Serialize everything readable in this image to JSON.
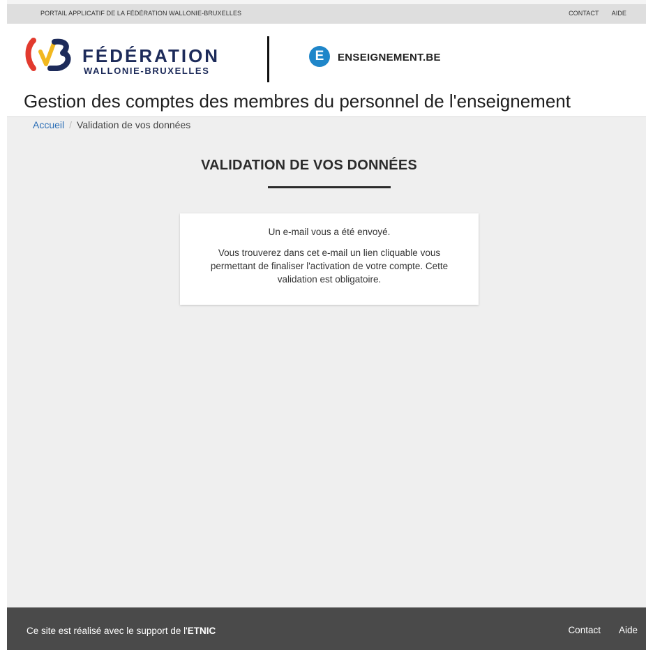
{
  "topbar": {
    "portal_text": "PORTAIL APPLICATIF DE LA FÉDÉRATION WALLONIE-BRUXELLES",
    "contact": "CONTACT",
    "aide": "AIDE"
  },
  "header": {
    "fwb_title": "FÉDÉRATION",
    "fwb_subtitle": "WALLONIE-BRUXELLES",
    "ens_letter": "E",
    "ens_text": "ENSEIGNEMENT.BE",
    "app_title": "Gestion des comptes des membres du personnel de l'enseignement"
  },
  "breadcrumb": {
    "home": "Accueil",
    "separator": "/",
    "current": "Validation de vos données"
  },
  "main": {
    "heading": "VALIDATION DE VOS DONNÉES",
    "message_line1": "Un e-mail vous a été envoyé.",
    "message_line2": "Vous trouverez dans cet e-mail un lien cliquable vous permettant de finaliser l'activation de votre compte. Cette validation est obligatoire."
  },
  "footer": {
    "support_prefix": "Ce site est réalisé avec le support de l'",
    "support_org": "ETNIC",
    "contact": "Contact",
    "aide": "Aide"
  },
  "colors": {
    "fwb_navy": "#1d2b5a",
    "fwb_red": "#e23a2e",
    "fwb_yellow": "#f2b81f",
    "ens_blue": "#1f86c9",
    "link_blue": "#2a6db5",
    "footer_bg": "#4a4a4a"
  }
}
